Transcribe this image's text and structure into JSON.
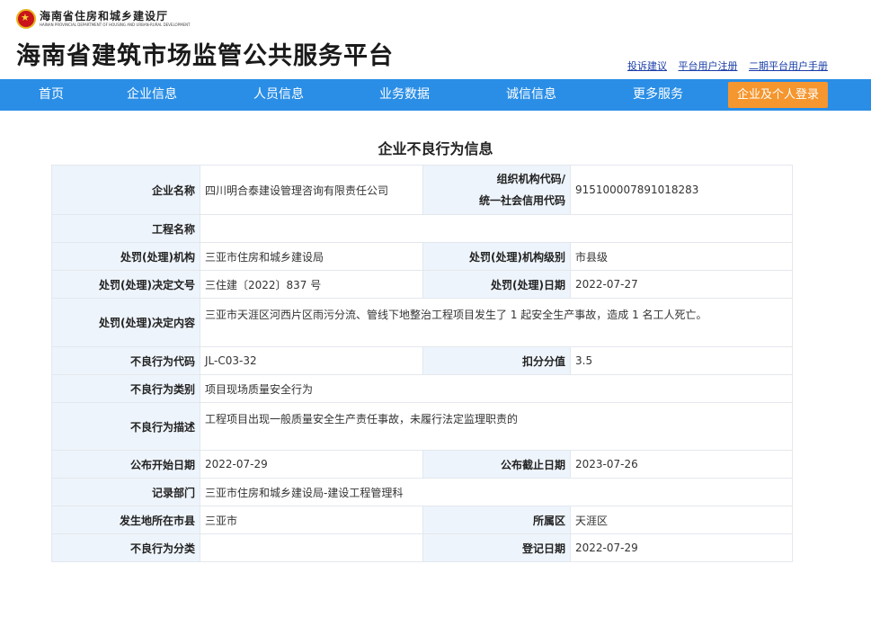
{
  "header": {
    "dept_name_cn": "海南省住房和城乡建设厅",
    "dept_name_en": "HAINAN PROVINCIAL DEPARTMENT OF HOUSING AND URBAN-RURAL DEVELOPMENT",
    "site_title": "海南省建筑市场监管公共服务平台",
    "links": [
      "投诉建议",
      "平台用户注册",
      "二期平台用户手册"
    ]
  },
  "nav": {
    "items": [
      "首页",
      "企业信息",
      "人员信息",
      "业务数据",
      "诚信信息",
      "更多服务"
    ],
    "login": "企业及个人登录"
  },
  "page_title": "企业不良行为信息",
  "fields": {
    "company_name": {
      "label": "企业名称",
      "value": "四川明合泰建设管理咨询有限责任公司"
    },
    "org_code": {
      "label_line1": "组织机构代码/",
      "label_line2": "统一社会信用代码",
      "value": "915100007891018283"
    },
    "project_name": {
      "label": "工程名称",
      "value": ""
    },
    "penalty_org": {
      "label": "处罚(处理)机构",
      "value": "三亚市住房和城乡建设局"
    },
    "penalty_org_level": {
      "label": "处罚(处理)机构级别",
      "value": "市县级"
    },
    "decision_no": {
      "label": "处罚(处理)决定文号",
      "value": "三住建〔2022〕837 号"
    },
    "penalty_date": {
      "label": "处罚(处理)日期",
      "value": "2022-07-27"
    },
    "decision_content": {
      "label": "处罚(处理)决定内容",
      "value": "三亚市天涯区河西片区雨污分流、管线下地整治工程项目发生了 1 起安全生产事故，造成 1 名工人死亡。"
    },
    "behavior_code": {
      "label": "不良行为代码",
      "value": "JL-C03-32"
    },
    "deduct_score": {
      "label": "扣分分值",
      "value": "3.5"
    },
    "behavior_category": {
      "label": "不良行为类别",
      "value": "项目现场质量安全行为"
    },
    "behavior_desc": {
      "label": "不良行为描述",
      "value": "工程项目出现一般质量安全生产责任事故，未履行法定监理职责的"
    },
    "publish_start": {
      "label": "公布开始日期",
      "value": "2022-07-29"
    },
    "publish_end": {
      "label": "公布截止日期",
      "value": "2023-07-26"
    },
    "record_dept": {
      "label": "记录部门",
      "value": "三亚市住房和城乡建设局-建设工程管理科"
    },
    "city": {
      "label": "发生地所在市县",
      "value": "三亚市"
    },
    "district": {
      "label": "所属区",
      "value": "天涯区"
    },
    "behavior_class": {
      "label": "不良行为分类",
      "value": ""
    },
    "register_date": {
      "label": "登记日期",
      "value": "2022-07-29"
    }
  }
}
